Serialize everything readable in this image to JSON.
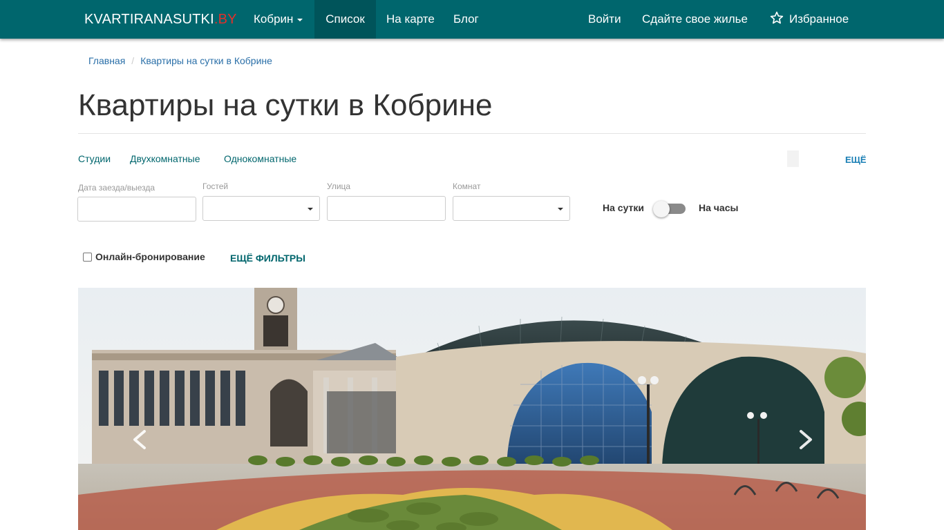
{
  "navbar": {
    "brand_main": "KVARTIRANASUTKI",
    "brand_tld": ".BY",
    "city_label": "Кобрин",
    "list_label": "Список",
    "map_label": "На карте",
    "blog_label": "Блог",
    "login_label": "Войти",
    "rent_out_label": "Сдайте свое жилье",
    "favorites_label": "Избранное",
    "colors": {
      "bar": "#00666d",
      "active": "#00545a",
      "tld": "#e2302b"
    }
  },
  "breadcrumb": {
    "home": "Главная",
    "separator": "/",
    "current": "Квартиры на сутки в Кобрине"
  },
  "page_title": "Квартиры на сутки в Кобрине",
  "quick_links": {
    "studios": "Студии",
    "two_room": "Двухкомнатные",
    "one_room": "Однокомнатные",
    "more": "ЕЩЁ"
  },
  "filters": {
    "dates_label": "Дата заезда/выезда",
    "dates_value": "",
    "guests_label": "Гостей",
    "guests_value": "",
    "street_label": "Улица",
    "street_value": "",
    "rooms_label": "Комнат",
    "rooms_value": "",
    "toggle_left": "На сутки",
    "toggle_right": "На часы",
    "online_booking_label": "Онлайн-бронирование",
    "online_booking_checked": false,
    "more_filters": "ЕЩЁ ФИЛЬТРЫ"
  },
  "carousel": {
    "prev_icon": "chevron-left-icon",
    "next_icon": "chevron-right-icon"
  }
}
